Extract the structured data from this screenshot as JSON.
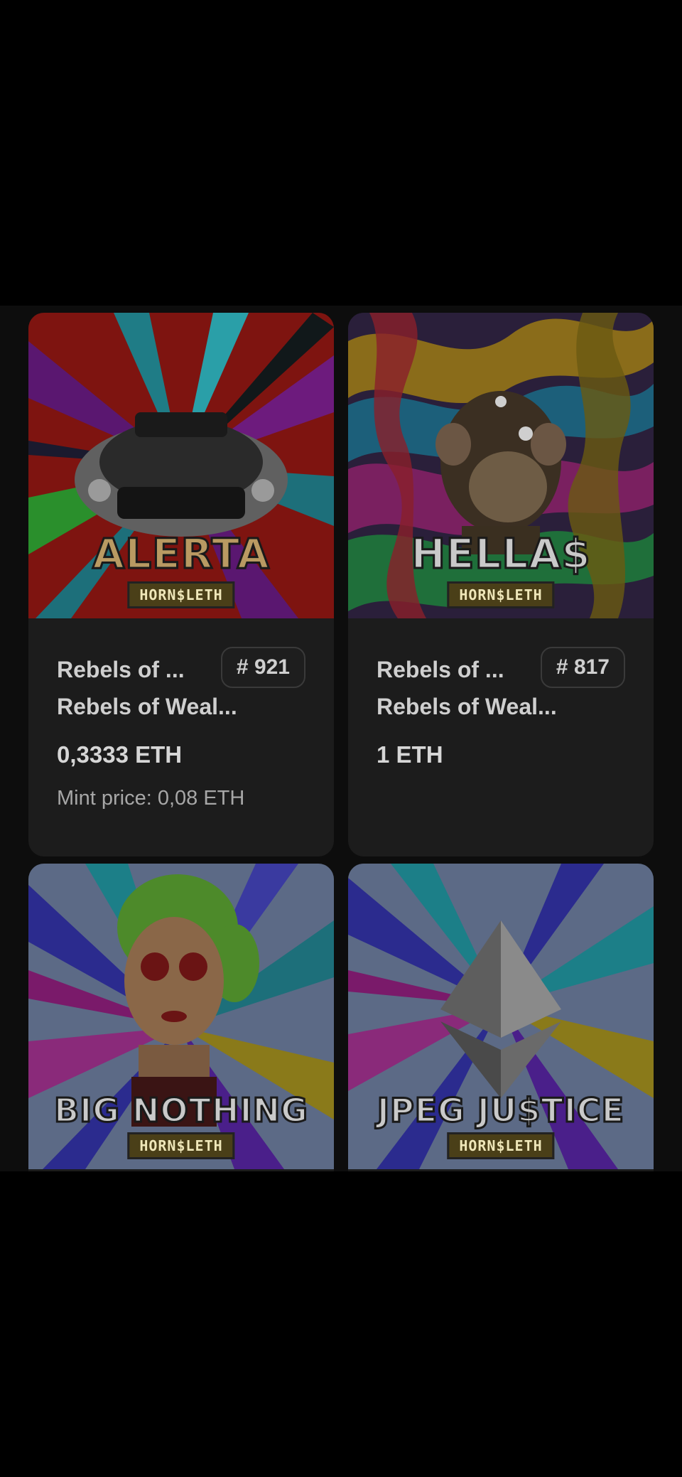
{
  "cards": [
    {
      "art_title": "ALERTA",
      "art_tag": "HORN$LETH",
      "name": "Rebels of ...",
      "token": "# 921",
      "collection": "Rebels of Weal...",
      "price": "0,3333 ETH",
      "mint_price": "Mint price: 0,08 ETH"
    },
    {
      "art_title": "HELLA$",
      "art_tag": "HORN$LETH",
      "name": "Rebels of ...",
      "token": "# 817",
      "collection": "Rebels of Weal...",
      "price": "1 ETH"
    },
    {
      "art_title": "BIG NOTHING",
      "art_tag": "HORN$LETH"
    },
    {
      "art_title": "JPEG JU$TICE",
      "art_tag": "HORN$LETH"
    }
  ],
  "colors": {
    "background": "#000000",
    "card": "#1c1c1c",
    "text": "#cfcfcf",
    "muted": "#a7a7a7"
  }
}
